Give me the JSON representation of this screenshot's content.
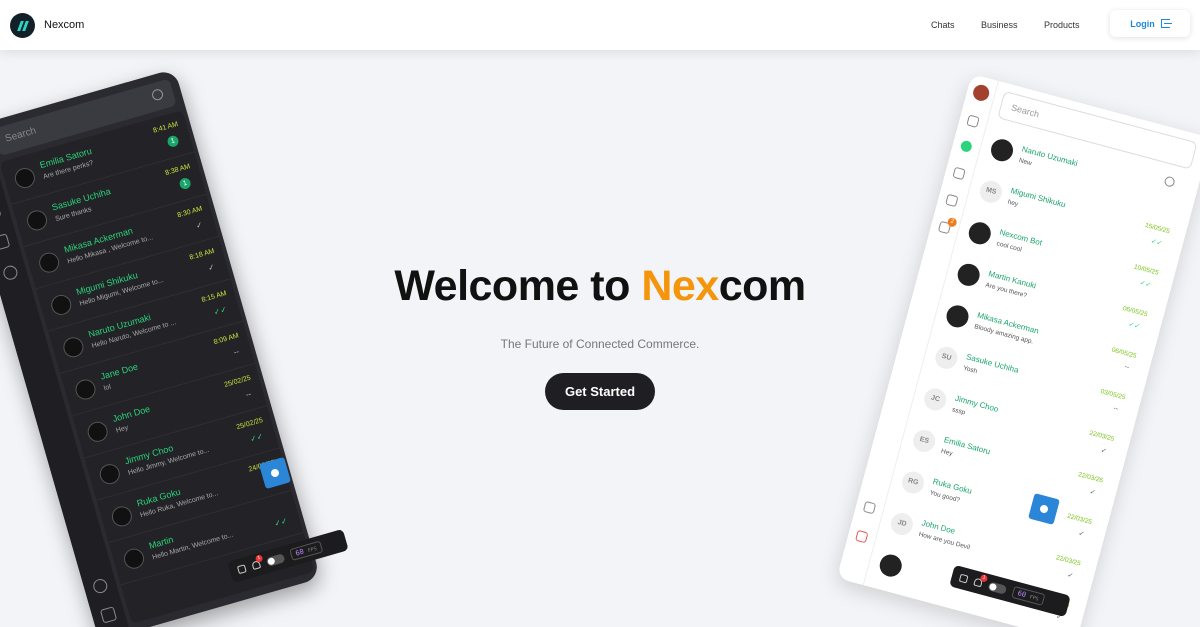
{
  "nav": {
    "brand": "Nexcom",
    "links": [
      "Chats",
      "Business",
      "Products"
    ],
    "login_label": "Login"
  },
  "hero": {
    "title_prefix": "Welcome to ",
    "title_accent": "Nex",
    "title_suffix": "com",
    "subtitle": "The Future of Connected Commerce.",
    "cta_label": "Get Started",
    "accent_color": "#f5950b"
  },
  "dark_preview": {
    "search_placeholder": "Search",
    "chats": [
      {
        "name": "Emilia Satoru",
        "message": "Are there perks?",
        "time": "8:41 AM",
        "badge": "1"
      },
      {
        "name": "Sasuke Uchiha",
        "message": "Sure thanks",
        "time": "8:38 AM",
        "badge": "1"
      },
      {
        "name": "Mikasa Ackerman",
        "message": "Hello Mikasa , Welcome to...",
        "time": "8:30 AM",
        "status": "✓"
      },
      {
        "name": "Migumi Shikuku",
        "message": "Hello Migumi, Welcome to...",
        "time": "8:18 AM",
        "status": "✓"
      },
      {
        "name": "Naruto Uzumaki",
        "message": "Hello Naruto, Welcome to ...",
        "time": "8:15 AM",
        "status": "✓✓"
      },
      {
        "name": "Jane Doe",
        "message": "lol",
        "time": "8:09 AM",
        "status": "--"
      },
      {
        "name": "John Doe",
        "message": "Hey",
        "time": "25/02/25",
        "status": "--"
      },
      {
        "name": "Jimmy Choo",
        "message": "Hello Jimmy, Welcome to...",
        "time": "25/02/25",
        "status": "✓✓"
      },
      {
        "name": "Ruka Goku",
        "message": "Hello Ruka, Welcome to...",
        "time": "24/02/25",
        "status": "✓"
      },
      {
        "name": "Martin",
        "message": "Hello Martin, Welcome to...",
        "time": "",
        "status": "✓✓"
      }
    ],
    "toolbar": {
      "badge": "1",
      "fps_value": "60",
      "fps_label": "FPS"
    }
  },
  "light_preview": {
    "search_placeholder": "Search",
    "chats": [
      {
        "initials": "",
        "name": "Naruto Uzumaki",
        "message": "New",
        "time": "",
        "status": ""
      },
      {
        "initials": "MS",
        "name": "Migumi Shikuku",
        "message": "hey",
        "time": "15/05/25",
        "status": "✓✓"
      },
      {
        "initials": "",
        "name": "Nexcom Bot",
        "message": "cool cool",
        "time": "10/05/25",
        "status": "✓✓"
      },
      {
        "initials": "",
        "name": "Martin Kanuki",
        "message": "Are you there?",
        "time": "06/05/25",
        "status": "✓✓"
      },
      {
        "initials": "",
        "name": "Mikasa Ackerman",
        "message": "Bloody amazing app.",
        "time": "06/05/25",
        "status": "--"
      },
      {
        "initials": "SU",
        "name": "Sasuke Uchiha",
        "message": "Yosh",
        "time": "03/05/25",
        "status": "--"
      },
      {
        "initials": "JC",
        "name": "Jimmy Choo",
        "message": "sssp",
        "time": "22/03/25",
        "status": "✓"
      },
      {
        "initials": "ES",
        "name": "Emilia Satoru",
        "message": "Hey",
        "time": "22/03/26",
        "status": "✓"
      },
      {
        "initials": "RG",
        "name": "Ruka Goku",
        "message": "You good?",
        "time": "22/03/25",
        "status": "✓"
      },
      {
        "initials": "JD",
        "name": "John Doe",
        "message": "How are you Devil",
        "time": "22/03/25",
        "status": "✓"
      },
      {
        "initials": "",
        "name": "",
        "message": "",
        "time": "22/03/25",
        "status": "✓"
      }
    ],
    "rail_badge": "2",
    "toolbar": {
      "badge": "1",
      "fps_value": "60",
      "fps_label": "FPS"
    }
  }
}
